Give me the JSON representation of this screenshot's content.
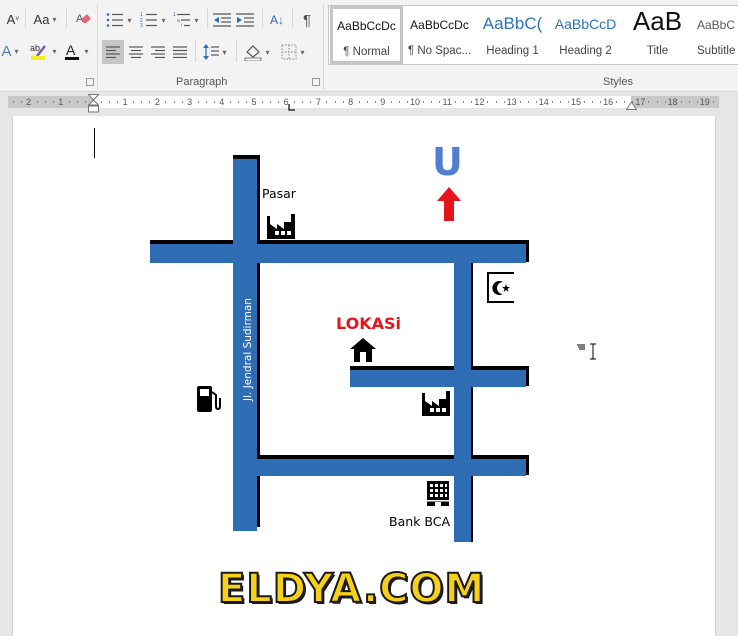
{
  "ribbon": {
    "font_group": {
      "shrink_font_label": "A",
      "change_case_label": "Aa",
      "text_effects_label": "A",
      "highlight_label": "ab",
      "font_color_label": "A"
    },
    "paragraph_group": {
      "label": "Paragraph",
      "sort_label": "A↓",
      "show_marks_label": "¶"
    },
    "styles_group": {
      "label": "Styles",
      "items": [
        {
          "preview": "AaBbCcDc",
          "name": "¶ Normal",
          "color": "#111111",
          "selected": true
        },
        {
          "preview": "AaBbCcDc",
          "name": "¶ No Spac...",
          "color": "#111111"
        },
        {
          "preview": "AaBbC(",
          "name": "Heading 1",
          "color": "#2e74b5"
        },
        {
          "preview": "AaBbCcD",
          "name": "Heading 2",
          "color": "#2e74b5"
        },
        {
          "preview": "AaB",
          "name": "Title",
          "color": "#111111"
        },
        {
          "preview": "AaBbC",
          "name": "Subtitle",
          "color": "#595959"
        }
      ]
    }
  },
  "ruler": {
    "left_numbers": [
      "2",
      "1"
    ],
    "right_numbers": [
      "1",
      "2",
      "3",
      "4",
      "5",
      "6",
      "7",
      "8",
      "9",
      "10",
      "11",
      "12",
      "13",
      "14",
      "15",
      "16",
      "17",
      "18",
      "19"
    ]
  },
  "map": {
    "north_label": "U",
    "street_label": "Jl. Jendral Sudirman",
    "landmarks": {
      "market": "Pasar",
      "location": "LOKASi",
      "bank": "Bank BCA"
    },
    "colors": {
      "road": "#2e6db3",
      "location": "#e8141c",
      "north_arrow": "#e8141c",
      "north_letter": "#4f7fd0"
    },
    "watermark": "ELDYA.COM"
  }
}
